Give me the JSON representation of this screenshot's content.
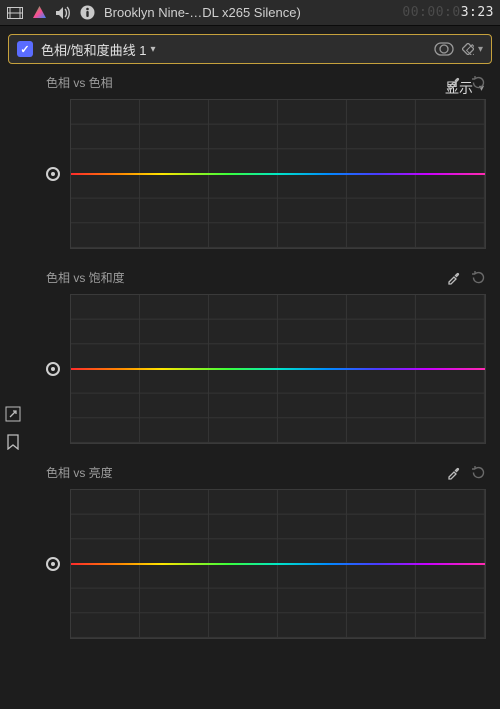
{
  "header": {
    "clip_title": "Brooklyn Nine-…DL x265 Silence)",
    "timecode_dim": "00:00:0",
    "timecode_hi": "3:23"
  },
  "effect": {
    "enabled": true,
    "name": "色相/饱和度曲线 1"
  },
  "show_menu_label": "显示",
  "panels": [
    {
      "title": "色相 vs 色相"
    },
    {
      "title": "色相 vs 饱和度"
    },
    {
      "title": "色相 vs 亮度"
    }
  ]
}
